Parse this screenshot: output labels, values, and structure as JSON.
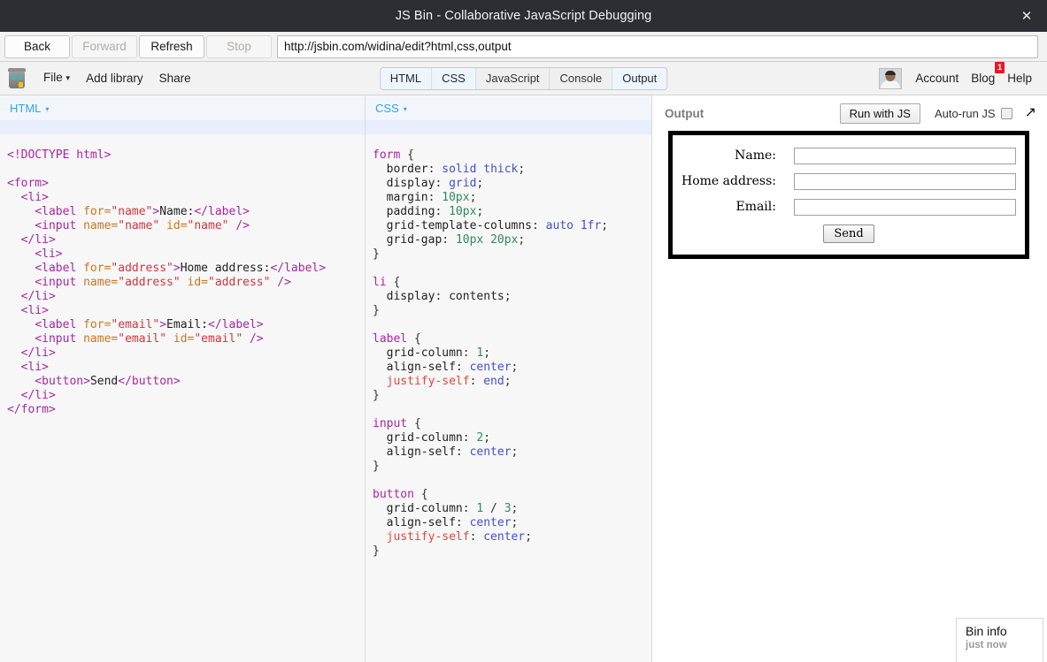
{
  "window": {
    "title": "JS Bin - Collaborative JavaScript Debugging",
    "close_label": "✕"
  },
  "browser": {
    "buttons": [
      {
        "label": "Back",
        "enabled": true
      },
      {
        "label": "Forward",
        "enabled": false
      },
      {
        "label": "Refresh",
        "enabled": true
      },
      {
        "label": "Stop",
        "enabled": false
      }
    ],
    "url": "http://jsbin.com/widina/edit?html,css,output"
  },
  "app": {
    "logo_name": "jsbin-robot-logo",
    "menu": [
      {
        "label": "File",
        "caret": "▾"
      },
      {
        "label": "Add library",
        "caret": ""
      },
      {
        "label": "Share",
        "caret": ""
      }
    ],
    "tabs": [
      {
        "label": "HTML",
        "active": true
      },
      {
        "label": "CSS",
        "active": true
      },
      {
        "label": "JavaScript",
        "active": false
      },
      {
        "label": "Console",
        "active": false
      },
      {
        "label": "Output",
        "active": true
      }
    ],
    "user": {
      "account_label": "Account",
      "blog_label": "Blog",
      "blog_badge": "1",
      "help_label": "Help"
    }
  },
  "panels": {
    "html": {
      "header": "HTML",
      "caret": "▾",
      "lines": [
        [],
        [
          {
            "t": "<!DOCTYPE html>",
            "c": "t-tag"
          }
        ],
        [],
        [
          {
            "t": "<form>",
            "c": "t-tag"
          }
        ],
        [
          {
            "t": "  ",
            "c": "t-txt"
          },
          {
            "t": "<li>",
            "c": "t-tag"
          }
        ],
        [
          {
            "t": "    ",
            "c": "t-txt"
          },
          {
            "t": "<label ",
            "c": "t-tag"
          },
          {
            "t": "for=",
            "c": "t-attr"
          },
          {
            "t": "\"name\"",
            "c": "t-val"
          },
          {
            "t": ">",
            "c": "t-tag"
          },
          {
            "t": "Name:",
            "c": "t-txt"
          },
          {
            "t": "</label>",
            "c": "t-tag"
          }
        ],
        [
          {
            "t": "    ",
            "c": "t-txt"
          },
          {
            "t": "<input ",
            "c": "t-tag"
          },
          {
            "t": "name=",
            "c": "t-attr"
          },
          {
            "t": "\"name\"",
            "c": "t-val"
          },
          {
            "t": " id=",
            "c": "t-attr"
          },
          {
            "t": "\"name\"",
            "c": "t-val"
          },
          {
            "t": " />",
            "c": "t-tag"
          }
        ],
        [
          {
            "t": "  ",
            "c": "t-txt"
          },
          {
            "t": "</li>",
            "c": "t-tag"
          }
        ],
        [
          {
            "t": "    ",
            "c": "t-txt"
          },
          {
            "t": "<li>",
            "c": "t-tag"
          }
        ],
        [
          {
            "t": "    ",
            "c": "t-txt"
          },
          {
            "t": "<label ",
            "c": "t-tag"
          },
          {
            "t": "for=",
            "c": "t-attr"
          },
          {
            "t": "\"address\"",
            "c": "t-val"
          },
          {
            "t": ">",
            "c": "t-tag"
          },
          {
            "t": "Home address:",
            "c": "t-txt"
          },
          {
            "t": "</label>",
            "c": "t-tag"
          }
        ],
        [
          {
            "t": "    ",
            "c": "t-txt"
          },
          {
            "t": "<input ",
            "c": "t-tag"
          },
          {
            "t": "name=",
            "c": "t-attr"
          },
          {
            "t": "\"address\"",
            "c": "t-val"
          },
          {
            "t": " id=",
            "c": "t-attr"
          },
          {
            "t": "\"address\"",
            "c": "t-val"
          },
          {
            "t": " />",
            "c": "t-tag"
          }
        ],
        [
          {
            "t": "  ",
            "c": "t-txt"
          },
          {
            "t": "</li>",
            "c": "t-tag"
          }
        ],
        [
          {
            "t": "  ",
            "c": "t-txt"
          },
          {
            "t": "<li>",
            "c": "t-tag"
          }
        ],
        [
          {
            "t": "    ",
            "c": "t-txt"
          },
          {
            "t": "<label ",
            "c": "t-tag"
          },
          {
            "t": "for=",
            "c": "t-attr"
          },
          {
            "t": "\"email\"",
            "c": "t-val"
          },
          {
            "t": ">",
            "c": "t-tag"
          },
          {
            "t": "Email:",
            "c": "t-txt"
          },
          {
            "t": "</label>",
            "c": "t-tag"
          }
        ],
        [
          {
            "t": "    ",
            "c": "t-txt"
          },
          {
            "t": "<input ",
            "c": "t-tag"
          },
          {
            "t": "name=",
            "c": "t-attr"
          },
          {
            "t": "\"email\"",
            "c": "t-val"
          },
          {
            "t": " id=",
            "c": "t-attr"
          },
          {
            "t": "\"email\"",
            "c": "t-val"
          },
          {
            "t": " />",
            "c": "t-tag"
          }
        ],
        [
          {
            "t": "  ",
            "c": "t-txt"
          },
          {
            "t": "</li>",
            "c": "t-tag"
          }
        ],
        [
          {
            "t": "  ",
            "c": "t-txt"
          },
          {
            "t": "<li>",
            "c": "t-tag"
          }
        ],
        [
          {
            "t": "    ",
            "c": "t-txt"
          },
          {
            "t": "<button>",
            "c": "t-tag"
          },
          {
            "t": "Send",
            "c": "t-txt"
          },
          {
            "t": "</button>",
            "c": "t-tag"
          }
        ],
        [
          {
            "t": "  ",
            "c": "t-txt"
          },
          {
            "t": "</li>",
            "c": "t-tag"
          }
        ],
        [
          {
            "t": "</form>",
            "c": "t-tag"
          }
        ]
      ]
    },
    "css": {
      "header": "CSS",
      "caret": "▾",
      "lines": [
        [],
        [
          {
            "t": "form",
            "c": "t-sel"
          },
          {
            "t": " {",
            "c": "t-punct"
          }
        ],
        [
          {
            "t": "  border",
            "c": "t-prop"
          },
          {
            "t": ": ",
            "c": "t-punct"
          },
          {
            "t": "solid thick",
            "c": "t-kw"
          },
          {
            "t": ";",
            "c": "t-punct"
          }
        ],
        [
          {
            "t": "  display",
            "c": "t-prop"
          },
          {
            "t": ": ",
            "c": "t-punct"
          },
          {
            "t": "grid",
            "c": "t-kw"
          },
          {
            "t": ";",
            "c": "t-punct"
          }
        ],
        [
          {
            "t": "  margin",
            "c": "t-prop"
          },
          {
            "t": ": ",
            "c": "t-punct"
          },
          {
            "t": "10px",
            "c": "t-num"
          },
          {
            "t": ";",
            "c": "t-punct"
          }
        ],
        [
          {
            "t": "  padding",
            "c": "t-prop"
          },
          {
            "t": ": ",
            "c": "t-punct"
          },
          {
            "t": "10px",
            "c": "t-num"
          },
          {
            "t": ";",
            "c": "t-punct"
          }
        ],
        [
          {
            "t": "  grid-template-columns",
            "c": "t-prop"
          },
          {
            "t": ": ",
            "c": "t-punct"
          },
          {
            "t": "auto 1fr",
            "c": "t-kw"
          },
          {
            "t": ";",
            "c": "t-punct"
          }
        ],
        [
          {
            "t": "  grid-gap",
            "c": "t-prop"
          },
          {
            "t": ": ",
            "c": "t-punct"
          },
          {
            "t": "10px 20px",
            "c": "t-num"
          },
          {
            "t": ";",
            "c": "t-punct"
          }
        ],
        [
          {
            "t": "}",
            "c": "t-punct"
          }
        ],
        [],
        [
          {
            "t": "li",
            "c": "t-sel"
          },
          {
            "t": " {",
            "c": "t-punct"
          }
        ],
        [
          {
            "t": "  display",
            "c": "t-prop"
          },
          {
            "t": ": ",
            "c": "t-punct"
          },
          {
            "t": "contents",
            "c": "t-prop"
          },
          {
            "t": ";",
            "c": "t-punct"
          }
        ],
        [
          {
            "t": "}",
            "c": "t-punct"
          }
        ],
        [],
        [
          {
            "t": "label",
            "c": "t-sel"
          },
          {
            "t": " {",
            "c": "t-punct"
          }
        ],
        [
          {
            "t": "  grid-column",
            "c": "t-prop"
          },
          {
            "t": ": ",
            "c": "t-punct"
          },
          {
            "t": "1",
            "c": "t-num"
          },
          {
            "t": ";",
            "c": "t-punct"
          }
        ],
        [
          {
            "t": "  align-self",
            "c": "t-prop"
          },
          {
            "t": ": ",
            "c": "t-punct"
          },
          {
            "t": "center",
            "c": "t-kw"
          },
          {
            "t": ";",
            "c": "t-punct"
          }
        ],
        [
          {
            "t": "  justify-self",
            "c": "t-propr"
          },
          {
            "t": ": ",
            "c": "t-punct"
          },
          {
            "t": "end",
            "c": "t-kw"
          },
          {
            "t": ";",
            "c": "t-punct"
          }
        ],
        [
          {
            "t": "}",
            "c": "t-punct"
          }
        ],
        [],
        [
          {
            "t": "input",
            "c": "t-sel"
          },
          {
            "t": " {",
            "c": "t-punct"
          }
        ],
        [
          {
            "t": "  grid-column",
            "c": "t-prop"
          },
          {
            "t": ": ",
            "c": "t-punct"
          },
          {
            "t": "2",
            "c": "t-num"
          },
          {
            "t": ";",
            "c": "t-punct"
          }
        ],
        [
          {
            "t": "  align-self",
            "c": "t-prop"
          },
          {
            "t": ": ",
            "c": "t-punct"
          },
          {
            "t": "center",
            "c": "t-kw"
          },
          {
            "t": ";",
            "c": "t-punct"
          }
        ],
        [
          {
            "t": "}",
            "c": "t-punct"
          }
        ],
        [],
        [
          {
            "t": "button",
            "c": "t-sel"
          },
          {
            "t": " {",
            "c": "t-punct"
          }
        ],
        [
          {
            "t": "  grid-column",
            "c": "t-prop"
          },
          {
            "t": ": ",
            "c": "t-punct"
          },
          {
            "t": "1",
            "c": "t-num"
          },
          {
            "t": " / ",
            "c": "t-punct"
          },
          {
            "t": "3",
            "c": "t-num"
          },
          {
            "t": ";",
            "c": "t-punct"
          }
        ],
        [
          {
            "t": "  align-self",
            "c": "t-prop"
          },
          {
            "t": ": ",
            "c": "t-punct"
          },
          {
            "t": "center",
            "c": "t-kw"
          },
          {
            "t": ";",
            "c": "t-punct"
          }
        ],
        [
          {
            "t": "  justify-self",
            "c": "t-propr"
          },
          {
            "t": ": ",
            "c": "t-punct"
          },
          {
            "t": "center",
            "c": "t-kw"
          },
          {
            "t": ";",
            "c": "t-punct"
          }
        ],
        [
          {
            "t": "}",
            "c": "t-punct"
          }
        ]
      ]
    },
    "output": {
      "header": "Output",
      "run_button": "Run with JS",
      "autorun_label": "Auto-run JS",
      "autorun_checked": false,
      "expand_icon": "↗",
      "rendered_form": {
        "fields": [
          {
            "label": "Name:",
            "value": ""
          },
          {
            "label": "Home address:",
            "value": ""
          },
          {
            "label": "Email:",
            "value": ""
          }
        ],
        "submit_label": "Send"
      }
    }
  },
  "bin_info": {
    "title": "Bin info",
    "subtitle": "just now"
  },
  "colors": {
    "titlebar_bg": "#2b2f33",
    "accent_blue": "#2aa3f0",
    "badge_red": "#e11b22",
    "active_line": "#e8eefc"
  }
}
